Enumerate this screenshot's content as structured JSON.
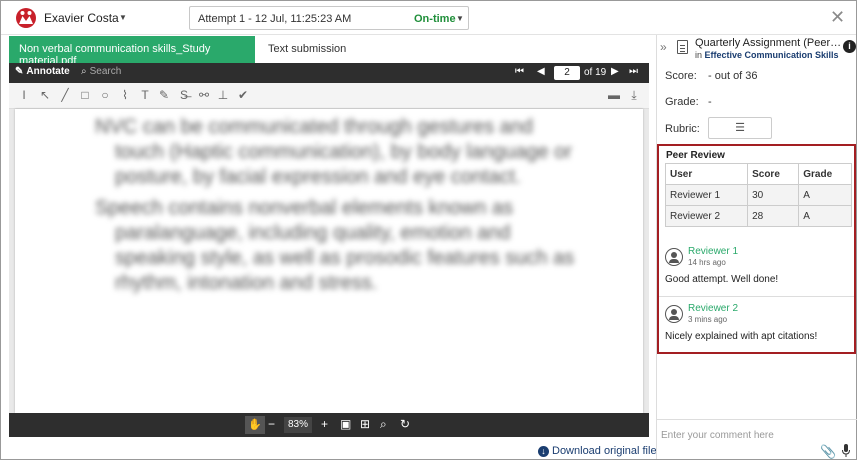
{
  "header": {
    "user_name": "Exavier Costa",
    "attempt_label": "Attempt 1 - 12 Jul, 11:25:23 AM",
    "attempt_status": "On-time"
  },
  "tabs": [
    {
      "label": "Non verbal communication skills_Study material.pdf",
      "active": true
    },
    {
      "label": "Text submission",
      "active": false
    }
  ],
  "viewer": {
    "annotate_label": "Annotate",
    "search_placeholder": "Search",
    "current_page": "2",
    "page_of": "of 19",
    "zoom": "83%",
    "download_label": "Download original file",
    "doc_paragraphs": [
      "NVC can be communicated through gestures and touch (Haptic communication), by body language or posture, by facial expression and eye contact.",
      "Speech contains nonverbal elements known as paralanguage, including quality, emotion and speaking style, as well as prosodic features such as rhythm, intonation and stress."
    ]
  },
  "assignment": {
    "title": "Quarterly Assignment (Peer Rev...",
    "in_prefix": "in",
    "course": "Effective Communication Skills",
    "score_label": "Score:",
    "score_value": "- out of 36",
    "grade_label": "Grade:",
    "grade_value": "-",
    "rubric_label": "Rubric:"
  },
  "peer_review": {
    "title": "Peer Review",
    "columns": [
      "User",
      "Score",
      "Grade"
    ],
    "rows": [
      {
        "user": "Reviewer 1",
        "score": "30",
        "grade": "A"
      },
      {
        "user": "Reviewer 2",
        "score": "28",
        "grade": "A"
      }
    ],
    "comments": [
      {
        "name": "Reviewer 1",
        "time": "14 hrs ago",
        "text": "Good attempt. Well done!"
      },
      {
        "name": "Reviewer 2",
        "time": "3 mins ago",
        "text": "Nicely explained with apt citations!"
      }
    ]
  },
  "comment_box": {
    "placeholder": "Enter your comment here"
  },
  "colors": {
    "accent_green": "#2aa96b",
    "on_time_green": "#1f8f3a",
    "highlight_border": "#a31e22",
    "toolbar_dark": "#2e2e2e",
    "link_navy": "#1a3d70"
  }
}
